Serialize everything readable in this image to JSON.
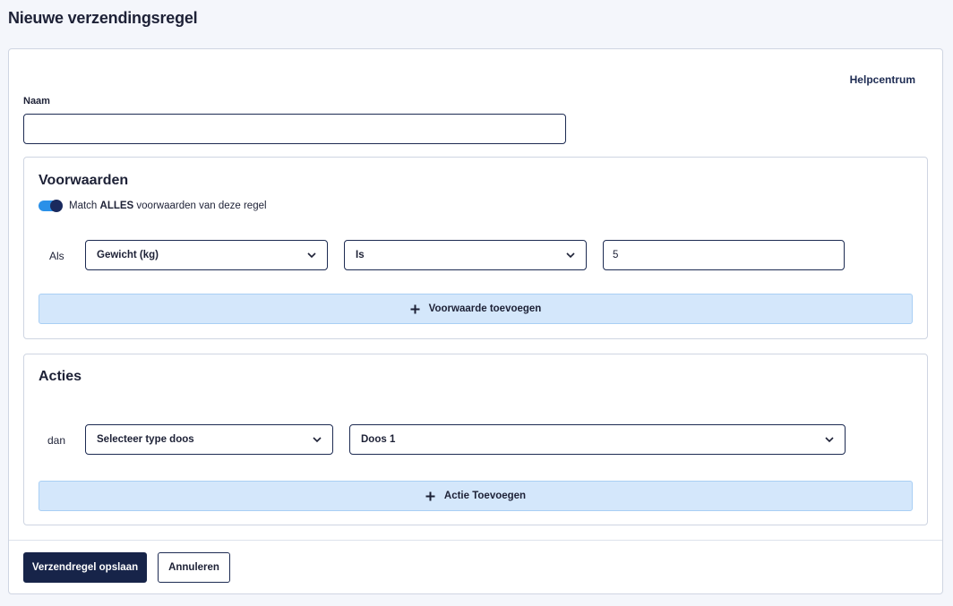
{
  "page": {
    "title": "Nieuwe verzendingsregel"
  },
  "help": {
    "label": "Helpcentrum"
  },
  "name_field": {
    "label": "Naam",
    "value": "",
    "placeholder": ""
  },
  "conditions": {
    "title": "Voorwaarden",
    "toggle": {
      "on": true,
      "prefix": "Match ",
      "emphasis": "ALLES",
      "suffix": " voorwaarden van deze regel"
    },
    "row": {
      "prefix": "Als",
      "field": "Gewicht (kg)",
      "operator": "Is",
      "value": "5"
    },
    "add_label": "Voorwaarde toevoegen"
  },
  "actions": {
    "title": "Acties",
    "row": {
      "prefix": "dan",
      "action_type": "Selecteer type doos",
      "action_value": "Doos 1"
    },
    "add_label": "Actie Toevoegen"
  },
  "footer": {
    "save_label": "Verzendregel opslaan",
    "cancel_label": "Annuleren"
  },
  "colors": {
    "primary": "#172449",
    "accent": "#2a90e8",
    "add_bar_bg": "#d4e7fb"
  }
}
